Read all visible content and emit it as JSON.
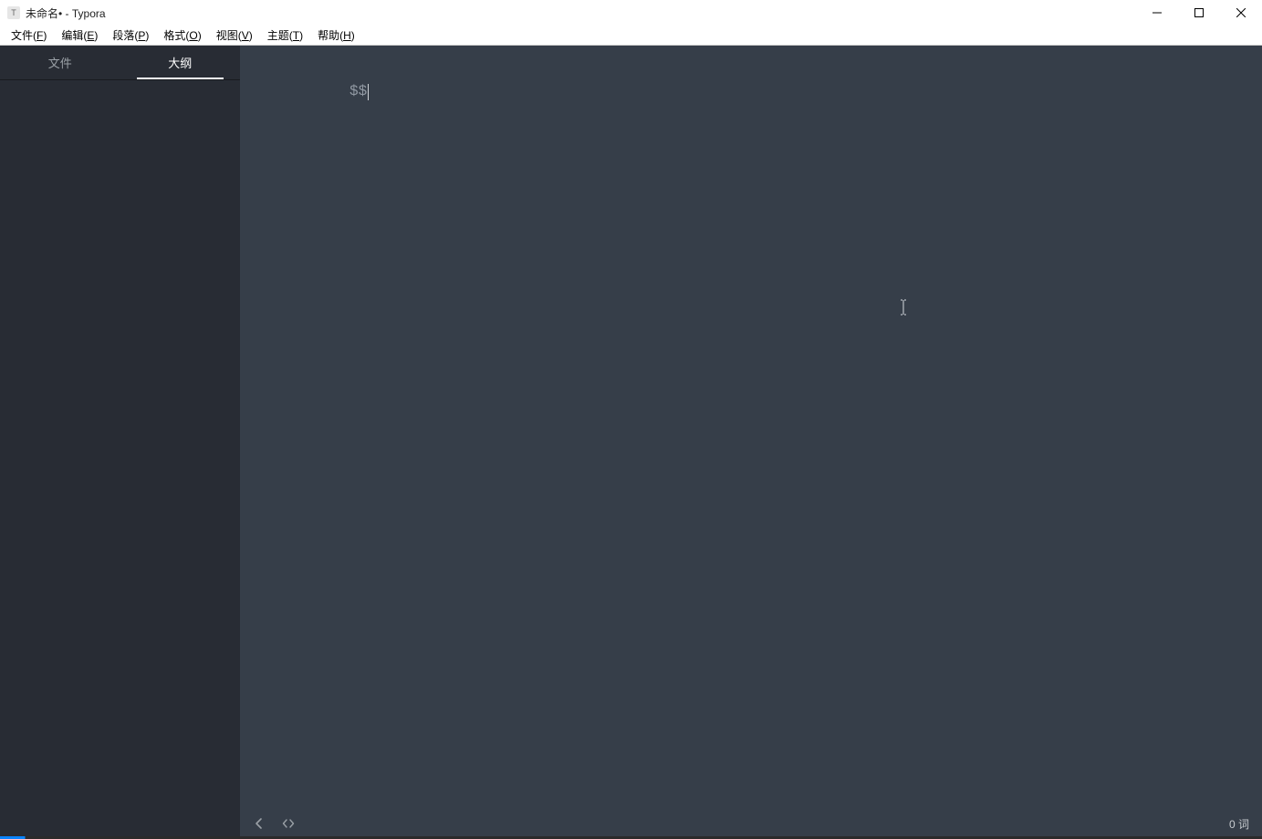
{
  "titlebar": {
    "app_icon_letter": "T",
    "title": "未命名• - Typora"
  },
  "menubar": {
    "items": [
      {
        "label_pre": "文件(",
        "hotkey": "F",
        "label_post": ")"
      },
      {
        "label_pre": "编辑(",
        "hotkey": "E",
        "label_post": ")"
      },
      {
        "label_pre": "段落(",
        "hotkey": "P",
        "label_post": ")"
      },
      {
        "label_pre": "格式(",
        "hotkey": "O",
        "label_post": ")"
      },
      {
        "label_pre": "视图(",
        "hotkey": "V",
        "label_post": ")"
      },
      {
        "label_pre": "主题(",
        "hotkey": "T",
        "label_post": ")"
      },
      {
        "label_pre": "帮助(",
        "hotkey": "H",
        "label_post": ")"
      }
    ]
  },
  "sidebar": {
    "tabs": [
      {
        "label": "文件",
        "active": false
      },
      {
        "label": "大纲",
        "active": true
      }
    ]
  },
  "editor": {
    "content": "$$"
  },
  "statusbar": {
    "word_count": "0 词"
  }
}
